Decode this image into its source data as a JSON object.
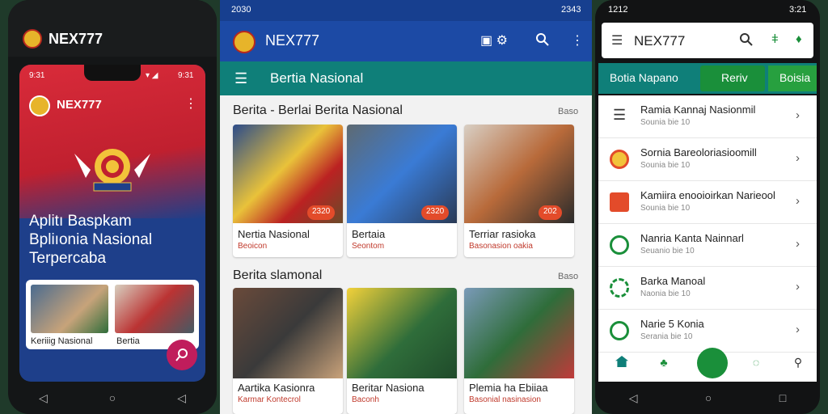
{
  "colors": {
    "primary_blue": "#1c4aa5",
    "teal": "#0f7f79",
    "red": "#d92b3a",
    "green": "#1a8f3a",
    "tag": "#e34b2a"
  },
  "phone1": {
    "brand": "NEX777",
    "status_time": "9:31",
    "status_right": "9:31",
    "app_brand": "NEX777",
    "headline": [
      "Aplitı Baspkam",
      "Bpliıonia Nasional",
      "Terpercaba"
    ],
    "cards": [
      {
        "title": "Keriiig Nasional"
      },
      {
        "title": "Bertia"
      }
    ]
  },
  "phone2": {
    "status_left": "2030",
    "status_right": "2343",
    "brand": "NEX777",
    "menu_title": "Bertia Nasional",
    "section1": {
      "title": "Berita - Berlai Berita Nasional",
      "more": "Baso",
      "cards": [
        {
          "title": "Nertia Nasional",
          "sub": "Beoicon",
          "tag": "2320"
        },
        {
          "title": "Bertaia",
          "sub": "Seontom",
          "tag": "2320"
        },
        {
          "title": "Terriar rasioka",
          "sub": "Basonasion oakia",
          "tag": "202"
        }
      ]
    },
    "section2": {
      "title": "Berita slamonal",
      "more": "Baso",
      "cards": [
        {
          "title": "Aartika Kasionra",
          "sub": "Karmar Kontecrol"
        },
        {
          "title": "Beritar Nasiona",
          "sub": "Baconh"
        },
        {
          "title": "Plemia ha Ebiiaa",
          "sub": "Basonial nasinasion"
        }
      ]
    }
  },
  "phone3": {
    "status_left": "1212",
    "status_right": "3:21",
    "brand": "NEX777",
    "tabs": [
      "Botia Napano",
      "Reriv",
      "Boisia"
    ],
    "rows": [
      {
        "title": "Ramia Kannaj Nasionmil",
        "sub": "Sounia bie 10",
        "icon": "menu-icon"
      },
      {
        "title": "Sornia Bareoloriasioomill",
        "sub": "Sounia bie 10",
        "icon": "emblem-icon"
      },
      {
        "title": "Kamiira enooioirkan Narieool",
        "sub": "Sounia bie 10",
        "icon": "card-icon"
      },
      {
        "title": "Nanria Kanta Nainnarl",
        "sub": "Seuanio bie 10",
        "icon": "globe-icon"
      },
      {
        "title": "Barka Manoal",
        "sub": "Naonia bie 10",
        "icon": "network-icon"
      },
      {
        "title": "Narie 5 Konia",
        "sub": "Serania bie 10",
        "icon": "share-icon"
      }
    ],
    "bottom_nav": [
      "Home",
      "",
      "",
      "",
      ""
    ]
  }
}
